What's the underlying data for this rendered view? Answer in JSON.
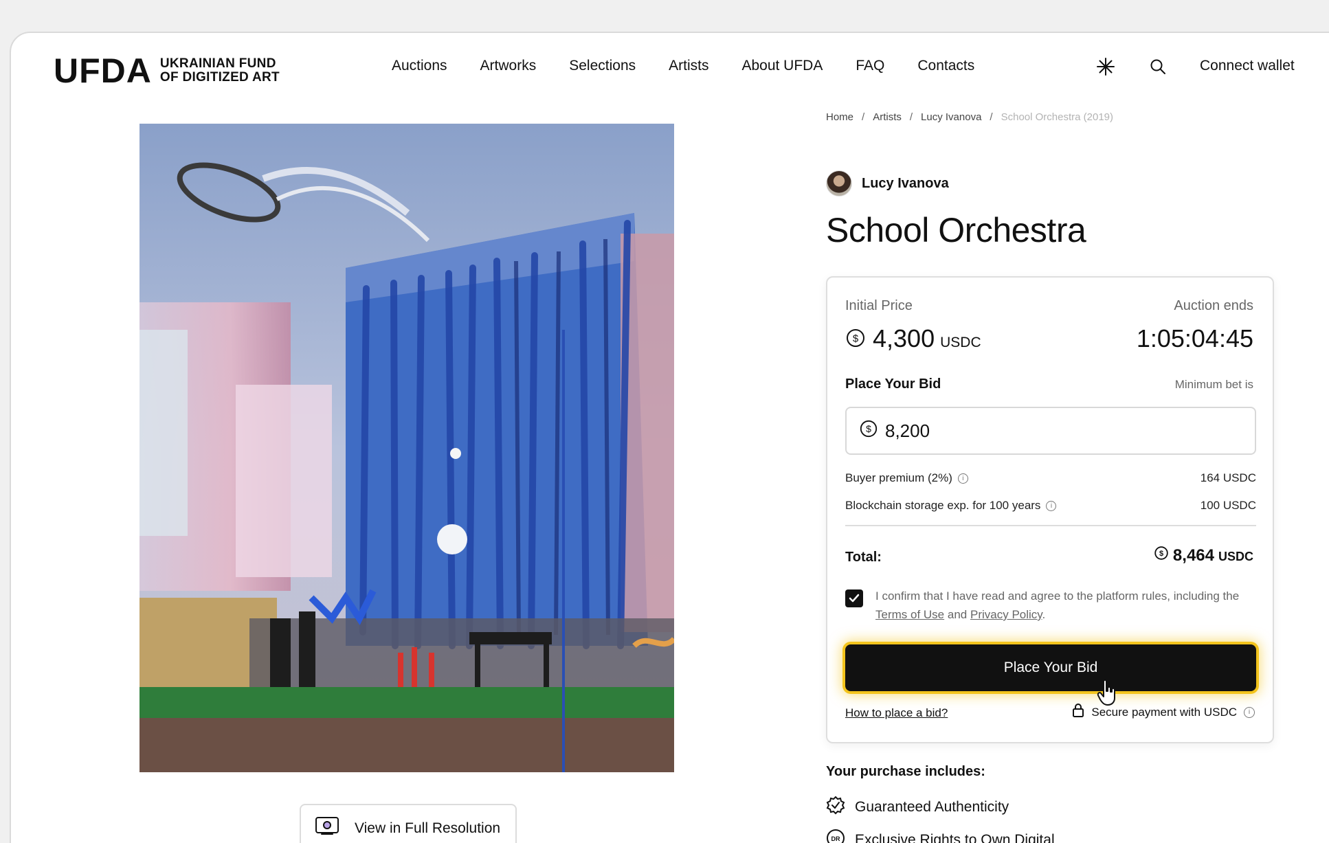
{
  "header": {
    "logo_mark": "UFDA",
    "logo_line1": "UKRAINIAN FUND",
    "logo_line2": "OF DIGITIZED ART",
    "nav": [
      "Auctions",
      "Artworks",
      "Selections",
      "Artists",
      "About UFDA",
      "FAQ",
      "Contacts"
    ],
    "connect_label": "Connect wallet"
  },
  "breadcrumb": [
    "Home",
    "Artists",
    "Lucy Ivanova",
    "School Orchestra (2019)"
  ],
  "artist": {
    "name": "Lucy Ivanova"
  },
  "artwork": {
    "title": "School Orchestra",
    "view_full_label": "View in Full Resolution"
  },
  "auction": {
    "initial_price_label": "Initial Price",
    "initial_price": "4,300",
    "currency": "USDC",
    "ends_label": "Auction ends",
    "countdown": "1:05:04:45",
    "bid_heading": "Place Your Bid",
    "min_bet_label": "Minimum bet is",
    "bid_value": "8,200",
    "buyer_premium_label": "Buyer premium (2%)",
    "buyer_premium_value": "164  USDC",
    "storage_label": "Blockchain storage exp. for 100 years",
    "storage_value": "100  USDC",
    "total_label": "Total:",
    "total_value": "8,464",
    "confirm_text": "I confirm that I have read and agree to the platform rules, including the",
    "terms_link": "Terms of Use",
    "and_text": "and",
    "privacy_link": "Privacy Policy",
    "period": ".",
    "place_bid_label": "Place Your Bid",
    "howto_label": "How to place a bid?",
    "secure_label": "Secure payment with USDC"
  },
  "purchase": {
    "heading": "Your purchase includes:",
    "items": [
      "Guaranteed Authenticity",
      "Exclusive Rights to Own Digital"
    ]
  },
  "colors": {
    "accent_glow": "#f3c41d",
    "primary": "#111111"
  }
}
